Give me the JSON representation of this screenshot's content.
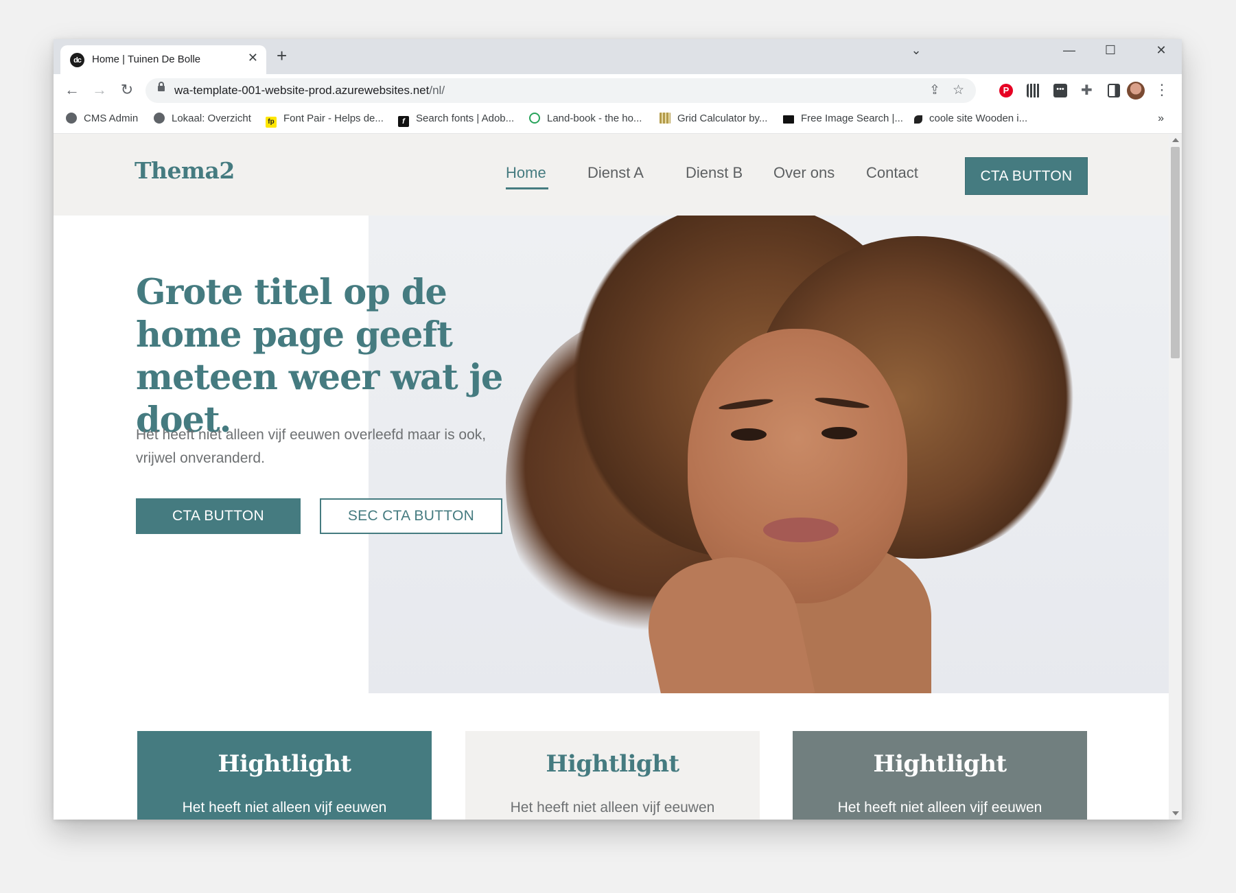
{
  "browser": {
    "tab": {
      "favicon_text": "dc",
      "title": "Home | Tuinen De Bolle",
      "close_glyph": "✕"
    },
    "new_tab_glyph": "+",
    "window_controls": {
      "list_tabs": "⌄",
      "minimize": "—",
      "maximize": "☐",
      "close": "✕"
    },
    "nav": {
      "back": "←",
      "forward": "→",
      "reload": "↻"
    },
    "address": {
      "host": "wa-template-001-website-prod.azurewebsites.net",
      "path": "/nl/"
    },
    "omnibox_icons": {
      "share": "⇪",
      "star": "☆"
    },
    "extensions": {
      "pinterest": "P",
      "more_menu": "⋮"
    },
    "bookmarks": [
      {
        "label": "CMS Admin",
        "icon": "globe-icon"
      },
      {
        "label": "Lokaal: Overzicht",
        "icon": "globe-icon"
      },
      {
        "label": "Font Pair - Helps de...",
        "icon": "fp-icon",
        "icon_text": "fp"
      },
      {
        "label": "Search fonts | Adob...",
        "icon": "adobe-fonts-icon",
        "icon_text": "f"
      },
      {
        "label": "Land-book - the ho...",
        "icon": "landbook-icon"
      },
      {
        "label": "Grid Calculator by...",
        "icon": "grid-icon"
      },
      {
        "label": "Free Image Search |...",
        "icon": "image-search-icon"
      },
      {
        "label": "coole site Wooden i...",
        "icon": "leaf-icon"
      }
    ],
    "bookmarks_overflow": "»"
  },
  "site": {
    "logo": "Thema2",
    "nav": [
      "Home",
      "Dienst A",
      "Dienst B",
      "Over ons",
      "Contact"
    ],
    "active_nav": "Home",
    "header_cta": "CTA BUTTON",
    "hero": {
      "title": "Grote titel op de home page geeft meteen weer wat je doet.",
      "text": "Het heeft niet alleen vijf eeuwen overleefd maar is ook, vrijwel onveranderd.",
      "cta_primary": "CTA BUTTON",
      "cta_secondary": "SEC CTA BUTTON",
      "image": "portrait of woman with curly hair"
    },
    "highlights": [
      {
        "title": "Hightlight",
        "text": "Het heeft niet alleen vijf eeuwen"
      },
      {
        "title": "Hightlight",
        "text": "Het heeft niet alleen vijf eeuwen"
      },
      {
        "title": "Hightlight",
        "text": "Het heeft niet alleen vijf eeuwen"
      }
    ]
  },
  "colors": {
    "brand_teal": "#457b80",
    "header_bg": "#f2f1ef",
    "slate": "#717f7f",
    "body_text": "#6d7072"
  }
}
